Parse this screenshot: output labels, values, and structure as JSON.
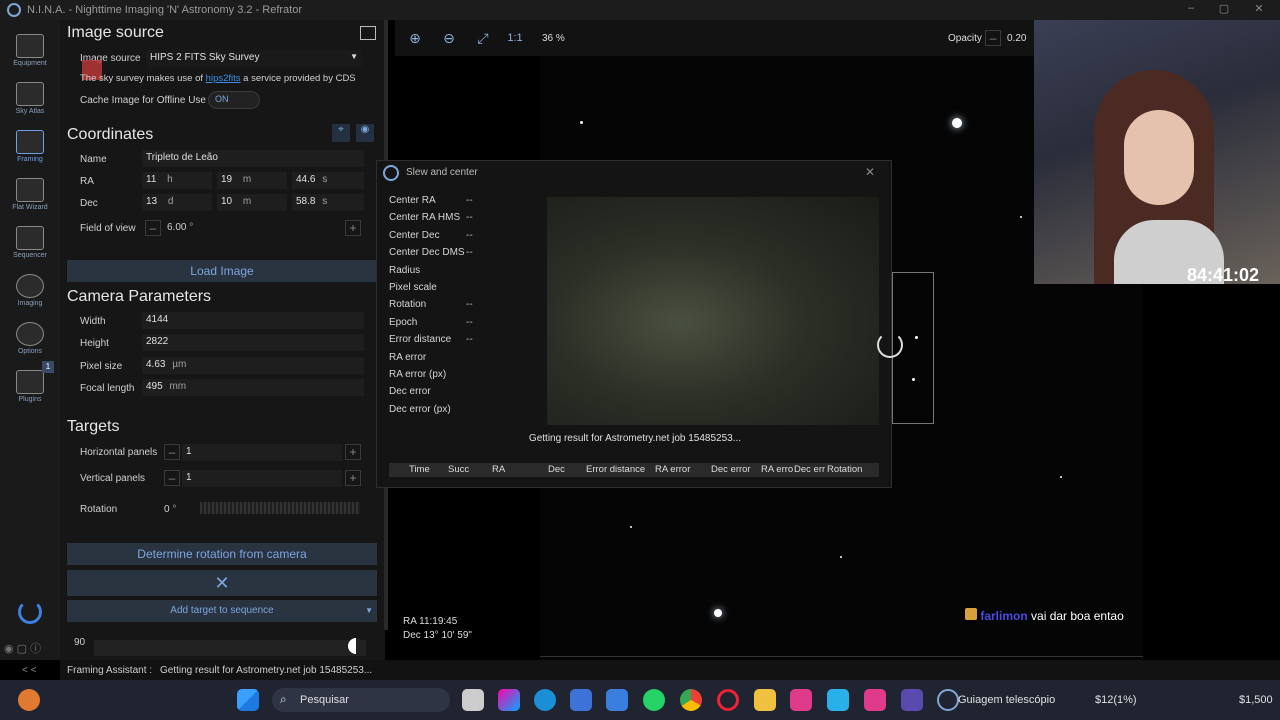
{
  "window": {
    "title": "N.I.N.A. - Nighttime Imaging 'N' Astronomy 3.2  -  Refrator"
  },
  "nav": [
    {
      "label": "Equipment"
    },
    {
      "label": "Sky Atlas"
    },
    {
      "label": "Framing"
    },
    {
      "label": "Flat Wizard"
    },
    {
      "label": "Sequencer"
    },
    {
      "label": "Imaging"
    },
    {
      "label": "Options"
    },
    {
      "label": "Plugins"
    }
  ],
  "plugins_badge": "1",
  "image_source": {
    "heading": "Image source",
    "source_label": "Image source",
    "source_value": "HIPS 2 FITS Sky Survey",
    "note_prefix": "The sky survey makes use of",
    "note_link": "hips2fits",
    "note_suffix": "a service provided by CDS",
    "cache_label": "Cache Image for Offline Use",
    "cache_state": "ON"
  },
  "coordinates": {
    "heading": "Coordinates",
    "name_label": "Name",
    "name_value": "Tripleto de Leão",
    "ra_label": "RA",
    "ra_h": "11",
    "ra_h_unit": "h",
    "ra_m": "19",
    "ra_m_unit": "m",
    "ra_s": "44.6",
    "ra_s_unit": "s",
    "dec_label": "Dec",
    "dec_d": "13",
    "dec_d_unit": "d",
    "dec_m": "10",
    "dec_m_unit": "m",
    "dec_s": "58.8",
    "dec_s_unit": "s",
    "fov_label": "Field of view",
    "fov_value": "6.00",
    "fov_unit": "°",
    "load_button": "Load Image"
  },
  "camera": {
    "heading": "Camera Parameters",
    "width_label": "Width",
    "width_value": "4144",
    "height_label": "Height",
    "height_value": "2822",
    "pixel_label": "Pixel size",
    "pixel_value": "4.63",
    "pixel_unit": "µm",
    "focal_label": "Focal length",
    "focal_value": "495",
    "focal_unit": "mm"
  },
  "targets": {
    "heading": "Targets",
    "hpanels_label": "Horizontal panels",
    "hpanels_value": "1",
    "vpanels_label": "Vertical panels",
    "vpanels_value": "1",
    "rotation_label": "Rotation",
    "rotation_value": "0",
    "rotation_unit": "°",
    "determine_button": "Determine rotation from camera",
    "add_button": "Add target to sequence",
    "bottom_value": "90"
  },
  "viewer": {
    "zoom": "36 %",
    "one_to_one": "1:1",
    "opacity_label": "Opacity",
    "opacity_value": "0.20",
    "ra_readout": "RA 11:19:45",
    "dec_readout": "Dec 13° 10' 59\""
  },
  "dialog": {
    "title": "Slew and center",
    "rows": [
      {
        "label": "Center RA",
        "value": "--"
      },
      {
        "label": "Center RA HMS",
        "value": "--"
      },
      {
        "label": "Center Dec",
        "value": "--"
      },
      {
        "label": "Center Dec DMS",
        "value": "--"
      },
      {
        "label": "Radius",
        "value": ""
      },
      {
        "label": "Pixel scale",
        "value": ""
      },
      {
        "label": "Rotation",
        "value": "--"
      },
      {
        "label": "Epoch",
        "value": "--"
      },
      {
        "label": "Error distance",
        "value": "--"
      },
      {
        "label": "RA error",
        "value": ""
      },
      {
        "label": "RA error (px)",
        "value": ""
      },
      {
        "label": "Dec error",
        "value": ""
      },
      {
        "label": "Dec error (px)",
        "value": ""
      }
    ],
    "status": "Getting result for Astrometry.net job 15485253...",
    "columns": [
      "Time",
      "Succ",
      "RA",
      "Dec",
      "Error distance",
      "RA error",
      "Dec error",
      "RA erro",
      "Dec err",
      "Rotation"
    ]
  },
  "statusbar": {
    "source": "Framing Assistant :",
    "message": "Getting result for Astrometry.net job 15485253...",
    "collapse": "< <"
  },
  "overlay": {
    "timer": "84:41:02",
    "chat_user": "farlimon",
    "chat_msg": "vai dar boa entao"
  },
  "taskbar": {
    "search": "Pesquisar",
    "app_label": "Guiagem telescópio",
    "stock": "$12(1%)",
    "price": "$1,500"
  },
  "colors": {
    "accent": "#6fa0e8",
    "link": "#3d8fe6",
    "panel_bg": "#161616"
  }
}
